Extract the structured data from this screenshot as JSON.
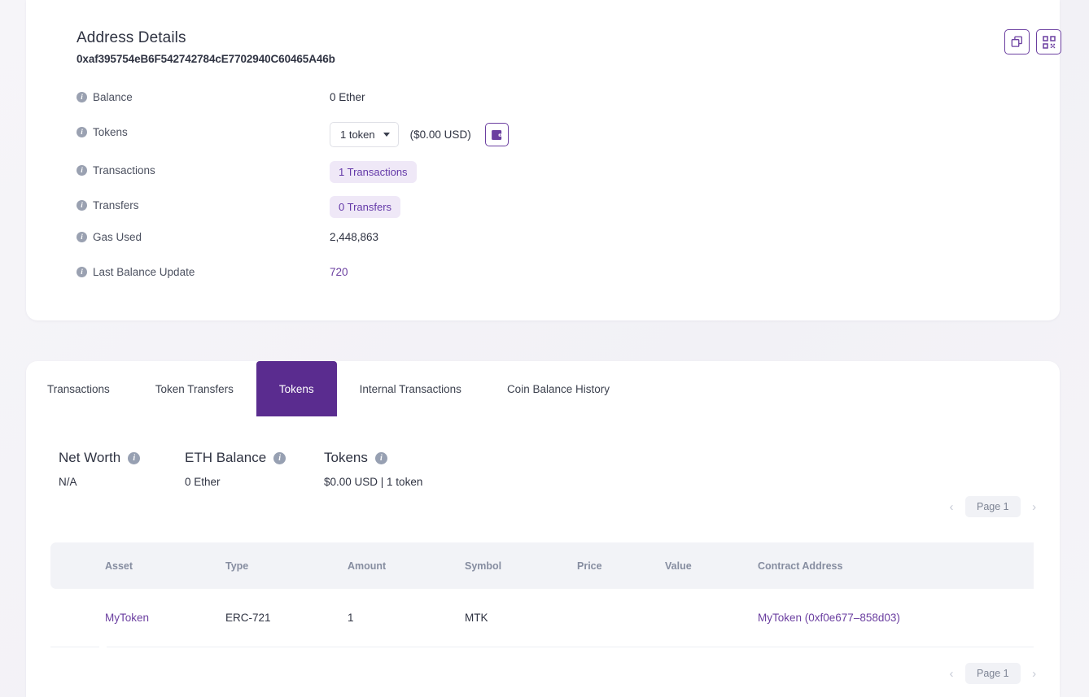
{
  "details": {
    "title": "Address Details",
    "address": "0xaf395754eB6F542742784cE7702940C60465A46b",
    "copy_icon": "copy-icon",
    "qr_icon": "qr-code-icon",
    "rows": [
      {
        "label": "Balance",
        "value": "0 Ether"
      },
      {
        "label": "Tokens",
        "value": ""
      },
      {
        "label": "Transactions",
        "value": "1 Transactions"
      },
      {
        "label": "Transfers",
        "value": "0 Transfers"
      },
      {
        "label": "Gas Used",
        "value": "2,448,863"
      },
      {
        "label": "Last Balance Update",
        "value": "720"
      }
    ],
    "tokens_select_value": "1 token",
    "tokens_usd": "($0.00 USD)",
    "wallet_icon": "wallet-icon"
  },
  "tabs": [
    {
      "label": "Transactions",
      "active": false
    },
    {
      "label": "Token Transfers",
      "active": false
    },
    {
      "label": "Tokens",
      "active": true
    },
    {
      "label": "Internal Transactions",
      "active": false
    },
    {
      "label": "Coin Balance History",
      "active": false
    }
  ],
  "stats": [
    {
      "title": "Net Worth",
      "value": "N/A"
    },
    {
      "title": "ETH Balance",
      "value": "0 Ether"
    },
    {
      "title": "Tokens",
      "value": "$0.00 USD | 1 token"
    }
  ],
  "pagination": {
    "prev": "‹",
    "page": "Page 1",
    "next": "›"
  },
  "table": {
    "columns": [
      "Asset",
      "Type",
      "Amount",
      "Symbol",
      "Price",
      "Value",
      "Contract Address"
    ],
    "rows": [
      {
        "asset": "MyToken",
        "type": "ERC-721",
        "amount": "1",
        "symbol": "MTK",
        "price": "",
        "value": "",
        "contract": "MyToken (0xf0e677–858d03)"
      }
    ]
  },
  "colors": {
    "accent": "#5a2c8f",
    "link": "#6b3fa0",
    "badge_bg": "#efe8f7",
    "page_bg": "#f4f3f7",
    "header_bg": "#f2f3f7"
  }
}
